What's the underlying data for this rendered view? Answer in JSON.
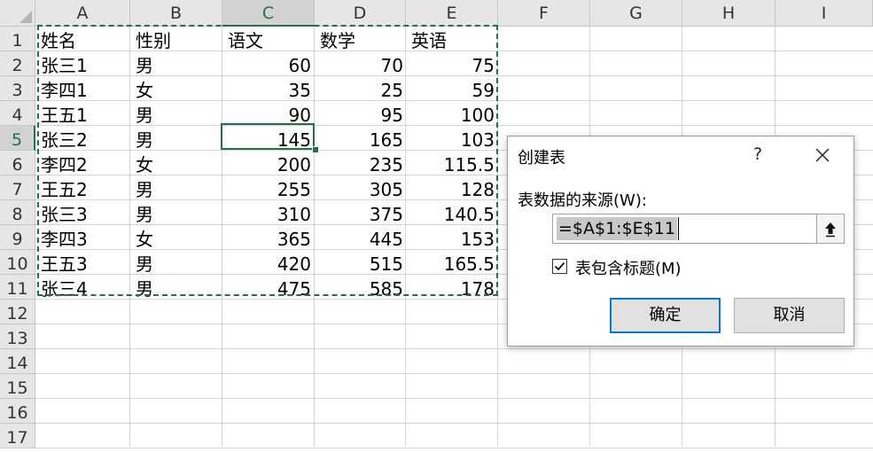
{
  "spreadsheet": {
    "columns": [
      "A",
      "B",
      "C",
      "D",
      "E",
      "F",
      "G",
      "H",
      "I"
    ],
    "rows": [
      "1",
      "2",
      "3",
      "4",
      "5",
      "6",
      "7",
      "8",
      "9",
      "10",
      "11",
      "12",
      "13",
      "14",
      "15",
      "16",
      "17"
    ],
    "selected_column": "C",
    "selected_row": "5",
    "table": [
      [
        "姓名",
        "性别",
        "语文",
        "数学",
        "英语"
      ],
      [
        "张三1",
        "男",
        "60",
        "70",
        "75"
      ],
      [
        "李四1",
        "女",
        "35",
        "25",
        "59"
      ],
      [
        "王五1",
        "男",
        "90",
        "95",
        "100"
      ],
      [
        "张三2",
        "男",
        "145",
        "165",
        "103"
      ],
      [
        "李四2",
        "女",
        "200",
        "235",
        "115.5"
      ],
      [
        "王五2",
        "男",
        "255",
        "305",
        "128"
      ],
      [
        "张三3",
        "男",
        "310",
        "375",
        "140.5"
      ],
      [
        "李四3",
        "女",
        "365",
        "445",
        "153"
      ],
      [
        "王五3",
        "男",
        "420",
        "515",
        "165.5"
      ],
      [
        "张三4",
        "男",
        "475",
        "585",
        "178"
      ]
    ]
  },
  "dialog": {
    "title": "创建表",
    "help": "?",
    "source_label": "表数据的来源(W):",
    "source_value": "=$A$1:$E$11",
    "has_headers_label": "表包含标题(M)",
    "has_headers_checked": true,
    "ok_label": "确定",
    "cancel_label": "取消"
  },
  "colors": {
    "accent_green": "#217346",
    "focus_blue": "#0078d7"
  }
}
